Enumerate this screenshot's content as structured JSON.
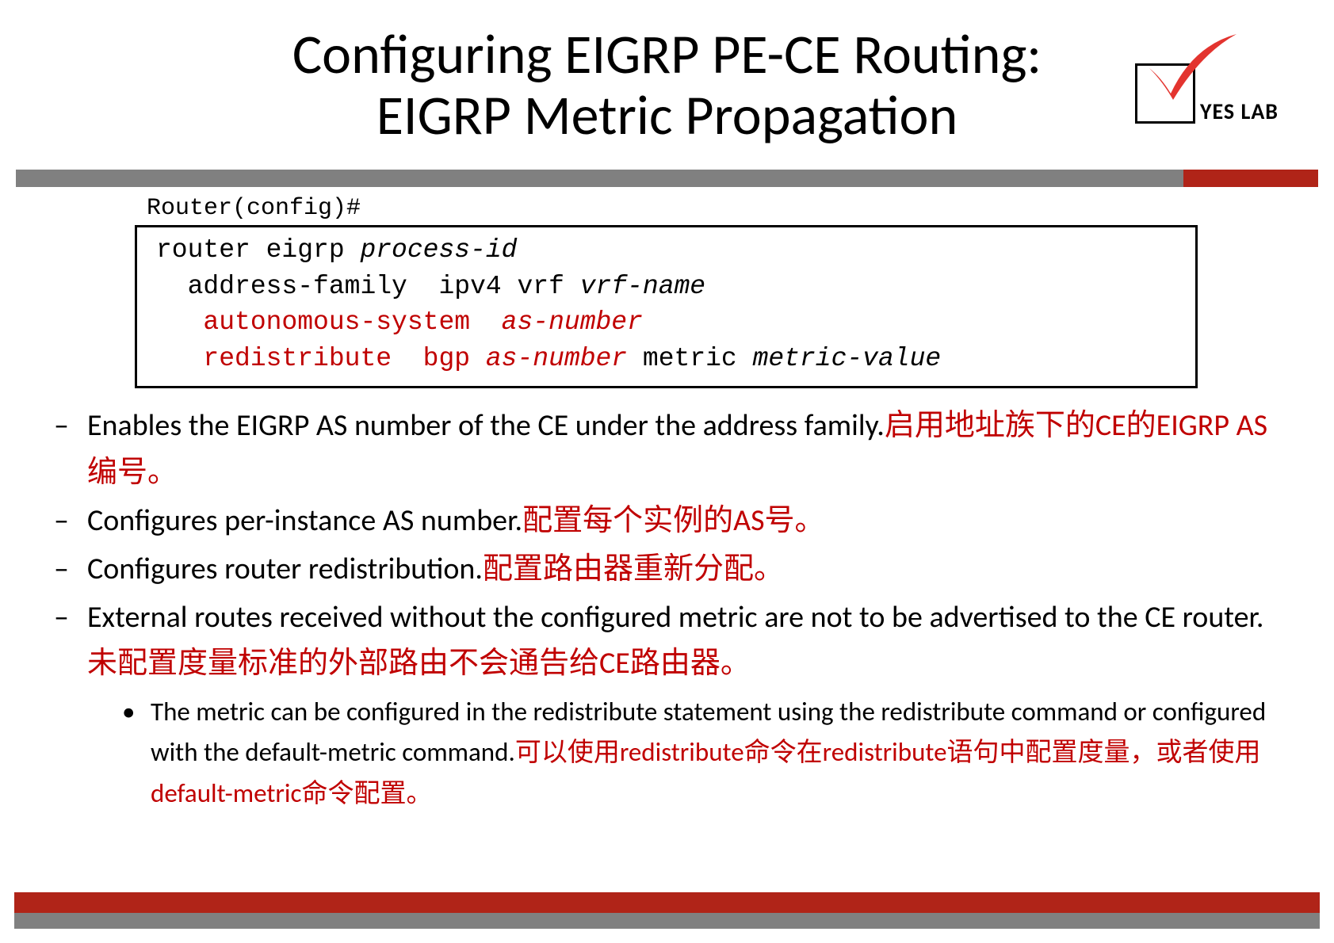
{
  "title": {
    "line1": "Configuring EIGRP PE-CE Routing:",
    "line2": "EIGRP Metric Propagation"
  },
  "logo": {
    "text": "YES LAB"
  },
  "prompt": {
    "left": "Router(config",
    "right": ")#"
  },
  "code": {
    "l1a": "router eigrp ",
    "l1b": "process-id",
    "l2a": "  address-family  ipv4 vrf ",
    "l2b": "vrf-name",
    "l3a": "   autonomous-system  ",
    "l3b": "as-number",
    "l4a": "   redistribute  bgp ",
    "l4b": "as-number",
    "l4c": " metric ",
    "l4d": "metric-value"
  },
  "bullets": {
    "b1": {
      "en": "Enables the EIGRP AS number of the CE under the address family.",
      "cn": "启用地址族下的CE的EIGRP AS编号。"
    },
    "b2": {
      "en": "Configures per-instance AS number.",
      "cn": "配置每个实例的AS号。"
    },
    "b3": {
      "en": "Configures router redistribution.",
      "cn": "配置路由器重新分配。"
    },
    "b4": {
      "en": "External routes received without the configured metric are not  to be advertised to the CE router.",
      "cn": "未配置度量标准的外部路由不会通告给CE路由器。"
    },
    "sub": {
      "en": "The metric can be configured in the redistribute statement using the  redistribute command or configured with the default-metric  command.",
      "cn": "可以使用redistribute命令在redistribute语句中配置度量，或者使用default-metric命令配置。"
    }
  },
  "colors": {
    "accent_red": "#b02418",
    "text_red": "#c00000",
    "gray": "#808080"
  }
}
